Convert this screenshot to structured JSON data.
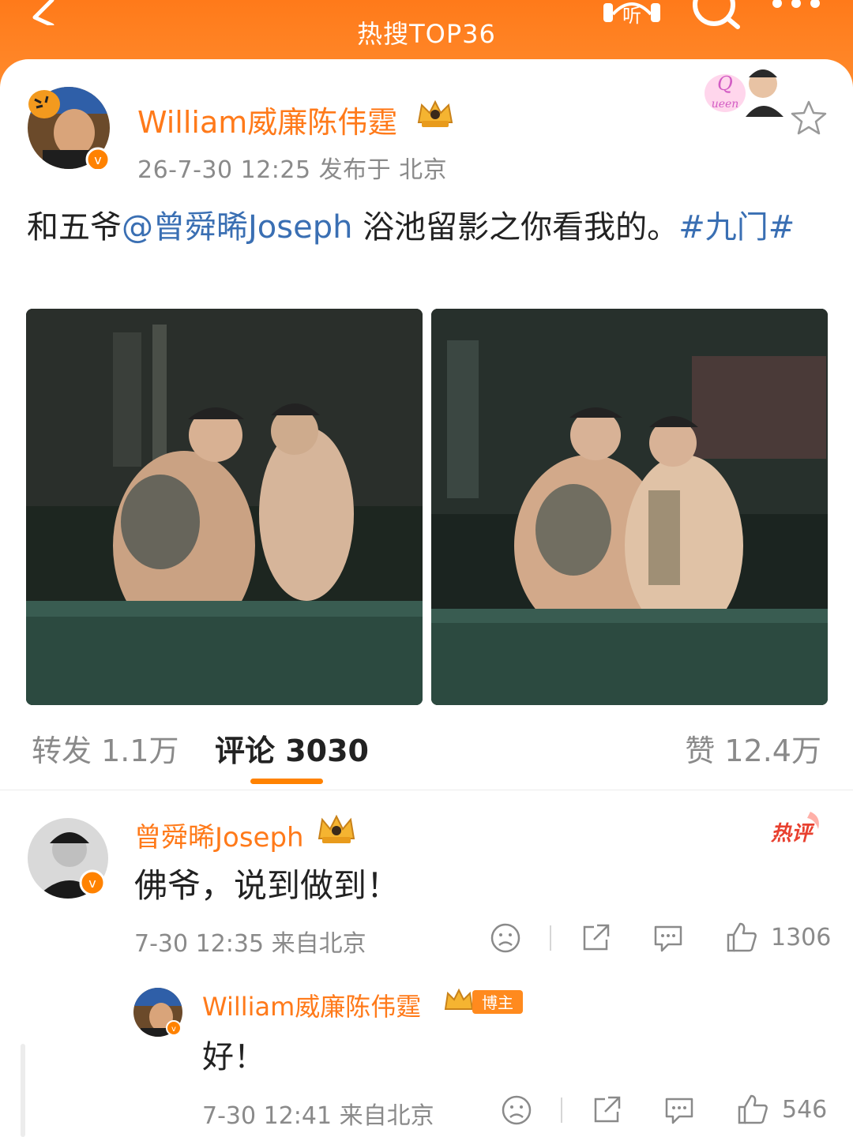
{
  "header": {
    "title": "热搜TOP36"
  },
  "post": {
    "author": "William威廉陈伟霆",
    "time_location": "26-7-30 12:25  发布于 北京",
    "text_prefix": "和五爷",
    "mention": "@曾舜晞Joseph",
    "text_mid": " 浴池留影之你看我的。",
    "topic": "#九门#"
  },
  "stats": {
    "repost": "转发 1.1万",
    "comment": "评论 3030",
    "like": "赞 12.4万"
  },
  "comment": {
    "author": "曾舜晞Joseph",
    "hot_label": "热评",
    "text": "佛爷，说到做到！",
    "meta": "7-30 12:35 来自北京",
    "like_count": "1306"
  },
  "reply": {
    "author": "William威廉陈伟霆",
    "author_tag": "博主",
    "text": "好！",
    "meta": "7-30 12:41 来自北京",
    "like_count": "546"
  },
  "icons": [
    "back-icon",
    "listen-icon",
    "search-icon",
    "more-icon",
    "star-icon",
    "dislike-icon",
    "share-icon",
    "reply-icon",
    "like-icon"
  ],
  "colors": {
    "header": "#ff7a1a",
    "name": "#ff7a1a",
    "link": "#3a6fb3",
    "tab_underline": "#ff8200"
  }
}
